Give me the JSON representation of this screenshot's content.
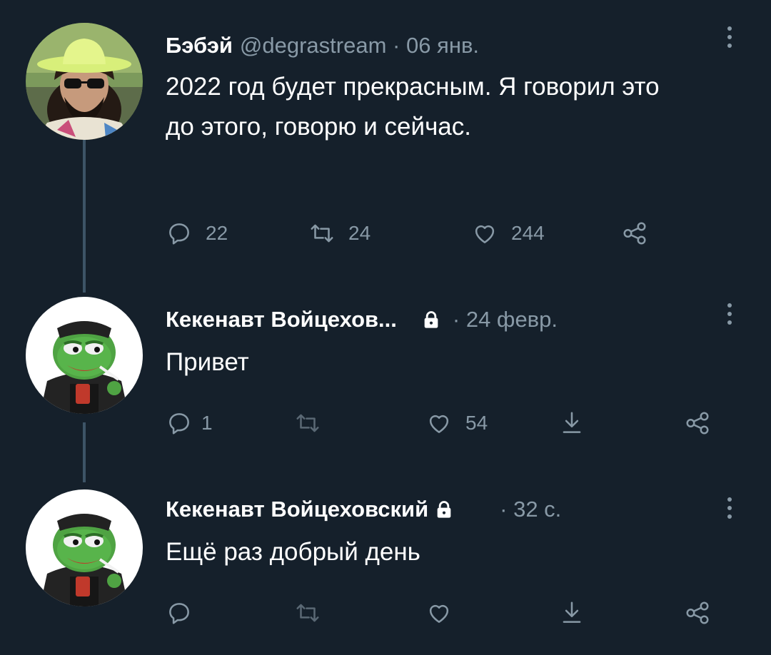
{
  "tweets": [
    {
      "name": "Бэбэй",
      "meta": "@degrastream · 06 янв.",
      "text": "2022 год будет прекрасным. Я говорил это до этого, говорю и сейчас.",
      "replies": "22",
      "retweets": "24",
      "likes": "244",
      "avatar": "man-with-yellow-hat-avatar"
    },
    {
      "name": "Кекенавт Войцехов...",
      "meta": "· 24 февр.",
      "text": "Привет",
      "replies": "1",
      "retweets": "",
      "likes": "54",
      "avatar": "pepe-frog-avatar"
    },
    {
      "name": "Кекенавт Войцеховский",
      "meta": "· 32 с.",
      "text": "Ещё раз добрый день",
      "replies": "",
      "retweets": "",
      "likes": "",
      "avatar": "pepe-frog-avatar"
    }
  ],
  "icons": {
    "reply": "reply-icon",
    "retweet": "retweet-icon",
    "like": "heart-icon",
    "share": "share-icon",
    "download": "download-icon",
    "lock": "lock-icon",
    "more": "more-vertical-icon"
  },
  "colors": {
    "background": "#15202b",
    "text": "#ffffff",
    "secondary": "#8899a6",
    "thread_line": "#3d5466"
  }
}
